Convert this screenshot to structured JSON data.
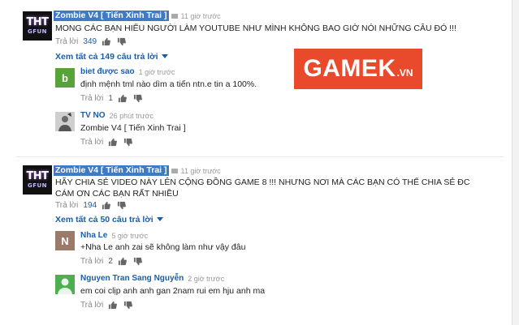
{
  "watermark": {
    "main": "GAMEK",
    "suffix": ".VN"
  },
  "threads": [
    {
      "avatar_line1": "THT",
      "avatar_line2": "GFUN",
      "author": "Zombie V4 [ Tiến Xinh Trai ]",
      "time": "11 giờ trước",
      "text": "MONG CÁC BẠN HIỂU NGƯỜI LÀM YOUTUBE NHƯ MÌNH KHÔNG BAO GIỜ NÓI NHỮNG CÂU ĐÓ !!!",
      "reply_label": "Trả lời",
      "likes": "349",
      "view_replies": "Xem tất cả 149 câu trả lời",
      "replies": [
        {
          "avatar_letter": "b",
          "avatar_color": "#57a33a",
          "author": "biet được sao",
          "time": "1 giờ trước",
          "text": "định mệnh tml nào dìm a tiến ntn.e tin a 100%.",
          "reply_label": "Trả lời",
          "likes": "1"
        },
        {
          "avatar_letter": "",
          "avatar_color": "#d8d8d8",
          "author": "TV NO",
          "time": "26 phút trước",
          "text": "Zombie V4 [ Tiến Xinh Trai ]",
          "reply_label": "Trả lời",
          "likes": ""
        }
      ]
    },
    {
      "avatar_line1": "THT",
      "avatar_line2": "GFUN",
      "author": "Zombie V4 [ Tiến Xinh Trai ]",
      "time": "11 giờ trước",
      "text": "HÃY CHIA SẺ VIDEO NÀY LÊN CỘNG ĐỒNG GAME 8 !!! NHƯNG NƠI MÀ CÁC BẠN CÓ THỂ CHIA SẺ ĐC CÁM ƠN CÁC BẠN RẤT NHIỀU",
      "reply_label": "Trả lời",
      "likes": "194",
      "view_replies": "Xem tất cả 50 câu trả lời",
      "replies": [
        {
          "avatar_letter": "N",
          "avatar_color": "#9c7a6a",
          "author": "Nha Le",
          "time": "5 giờ trước",
          "text": "+Nha Le anh zai sẽ không làm như vậy đâu",
          "reply_label": "Trả lời",
          "likes": "2"
        },
        {
          "avatar_letter": "",
          "avatar_color": "#4caf50",
          "author": "Nguyen Tran Sang Nguyễn",
          "time": "2 giờ trước",
          "text": "em coi clịp anh anh gan 2nam rui em hju anh ma",
          "reply_label": "Trả lời",
          "likes": ""
        }
      ]
    }
  ]
}
